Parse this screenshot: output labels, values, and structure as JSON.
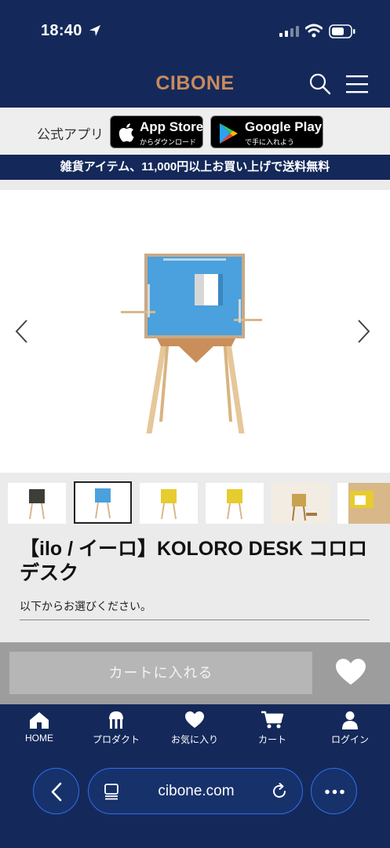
{
  "status_bar": {
    "time": "18:40"
  },
  "header": {
    "logo": "CIBONE"
  },
  "app_banner": {
    "label": "公式アプリ",
    "app_store": {
      "title": "App Store",
      "sub": "からダウンロード"
    },
    "google_play": {
      "title": "Google Play",
      "sub": "で手に入れよう"
    }
  },
  "shipping_notice": "雑貨アイテム、11,000円以上お買い上げで送料無料",
  "product": {
    "title": "【ilo / イーロ】KOLORO DESK コロロ デスク",
    "select_note": "以下からお選びください。",
    "thumbnail_colors": [
      "#3b3f38",
      "#4aa1dd",
      "#e7cc2f",
      "#e7cc2f",
      "#c9a24f",
      "#d8b889"
    ],
    "active_thumbnail": 1
  },
  "cart": {
    "add_label": "カートに入れる"
  },
  "bottom_nav": {
    "items": [
      {
        "label": "HOME"
      },
      {
        "label": "プロダクト"
      },
      {
        "label": "お気に入り"
      },
      {
        "label": "カート"
      },
      {
        "label": "ログイン"
      }
    ]
  },
  "browser": {
    "url": "cibone.com"
  },
  "colors": {
    "navy": "#14295a",
    "logo": "#c98a5e",
    "accent_blue": "#2f6ff0"
  }
}
